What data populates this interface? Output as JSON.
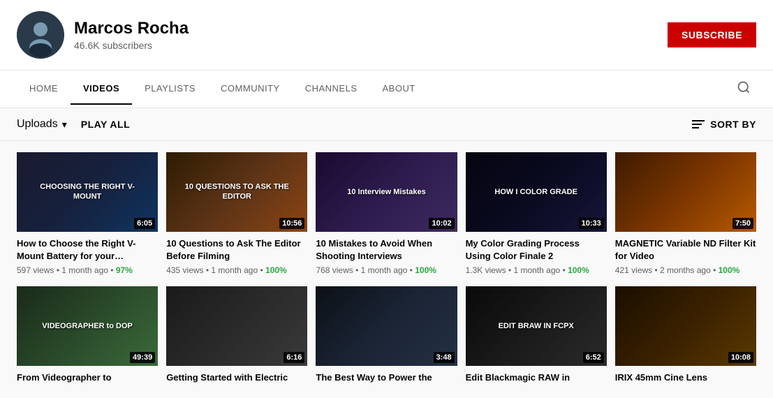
{
  "header": {
    "channel_name": "Marcos Rocha",
    "subscribers": "46.6K subscribers",
    "subscribe_label": "SUBSCRIBE"
  },
  "nav": {
    "items": [
      {
        "id": "home",
        "label": "HOME",
        "active": false
      },
      {
        "id": "videos",
        "label": "VIDEOS",
        "active": true
      },
      {
        "id": "playlists",
        "label": "PLAYLISTS",
        "active": false
      },
      {
        "id": "community",
        "label": "COMMUNITY",
        "active": false
      },
      {
        "id": "channels",
        "label": "CHANNELS",
        "active": false
      },
      {
        "id": "about",
        "label": "ABOUT",
        "active": false
      }
    ]
  },
  "toolbar": {
    "uploads_label": "Uploads",
    "play_all_label": "PLAY ALL",
    "sort_by_label": "SORT BY"
  },
  "videos": [
    {
      "id": 1,
      "title": "How to Choose the Right V-Mount Battery for your…",
      "thumb_label": "CHOOSING THE RIGHT V-MOUNT",
      "thumb_class": "thumb-1",
      "duration": "6:05",
      "views": "597 views",
      "age": "1 month ago",
      "match": "97%"
    },
    {
      "id": 2,
      "title": "10 Questions to Ask The Editor Before Filming",
      "thumb_label": "10 QUESTIONS TO ASK THE EDITOR",
      "thumb_class": "thumb-2",
      "duration": "10:56",
      "views": "435 views",
      "age": "1 month ago",
      "match": "100%"
    },
    {
      "id": 3,
      "title": "10 Mistakes to Avoid When Shooting Interviews",
      "thumb_label": "10 Interview Mistakes",
      "thumb_class": "thumb-3",
      "duration": "10:02",
      "views": "768 views",
      "age": "1 month ago",
      "match": "100%"
    },
    {
      "id": 4,
      "title": "My Color Grading Process Using Color Finale 2",
      "thumb_label": "HOW I COLOR GRADE",
      "thumb_class": "thumb-4",
      "duration": "10:33",
      "views": "1.3K views",
      "age": "1 month ago",
      "match": "100%"
    },
    {
      "id": 5,
      "title": "MAGNETIC Variable ND Filter Kit for Video",
      "thumb_label": "",
      "thumb_class": "thumb-5",
      "duration": "7:50",
      "views": "421 views",
      "age": "2 months ago",
      "match": "100%"
    },
    {
      "id": 6,
      "title": "From Videographer to",
      "thumb_label": "VIDEOGRAPHER\nto\nDOP",
      "thumb_class": "thumb-6",
      "duration": "49:39",
      "views": "",
      "age": "",
      "match": ""
    },
    {
      "id": 7,
      "title": "Getting Started with Electric",
      "thumb_label": "",
      "thumb_class": "thumb-7",
      "duration": "6:16",
      "views": "",
      "age": "",
      "match": ""
    },
    {
      "id": 8,
      "title": "The Best Way to Power the",
      "thumb_label": "",
      "thumb_class": "thumb-8",
      "duration": "3:48",
      "views": "",
      "age": "",
      "match": ""
    },
    {
      "id": 9,
      "title": "Edit Blackmagic RAW in",
      "thumb_label": "EDIT BRAW IN FCPX",
      "thumb_class": "thumb-9",
      "duration": "6:52",
      "views": "",
      "age": "",
      "match": ""
    },
    {
      "id": 10,
      "title": "IRIX 45mm Cine Lens",
      "thumb_label": "",
      "thumb_class": "thumb-10",
      "duration": "10:08",
      "views": "",
      "age": "",
      "match": ""
    }
  ]
}
